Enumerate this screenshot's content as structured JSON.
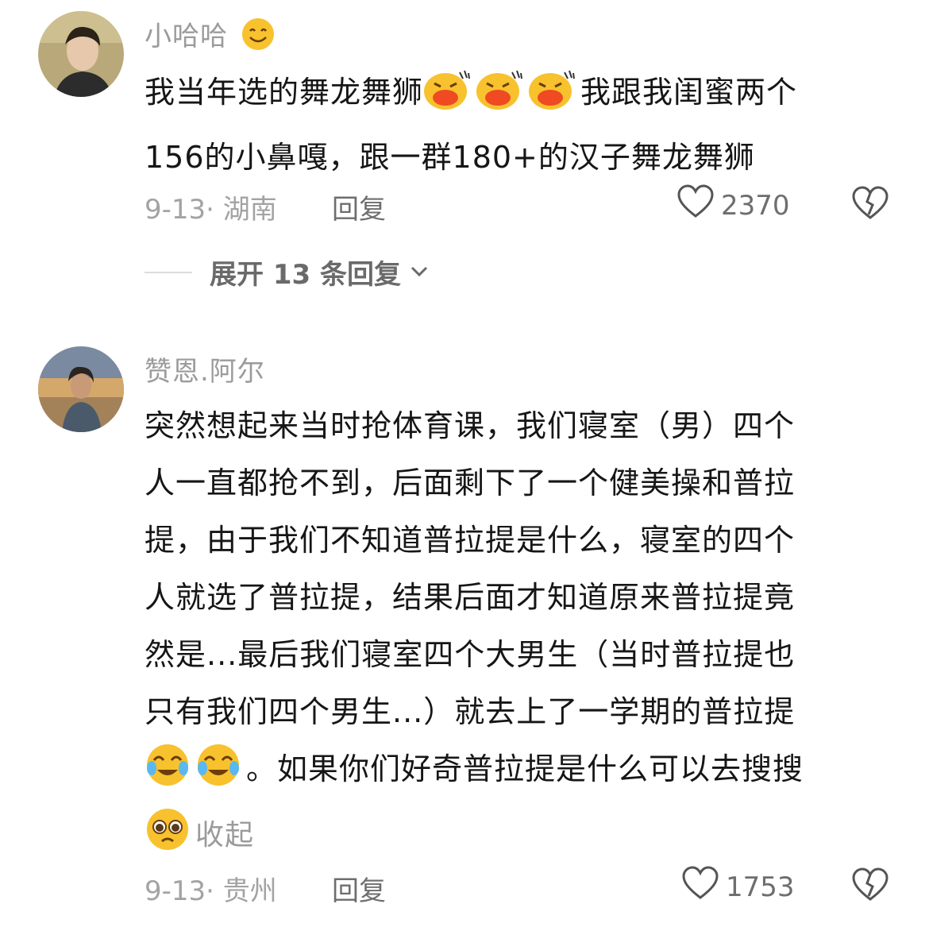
{
  "comments": [
    {
      "username": "小哈哈",
      "text_line1_before": "我当年选的舞龙舞狮",
      "text_line1_after": "我跟我闺蜜两个",
      "text_line2": "156的小鼻嘎，跟一群180+的汉子舞龙舞狮",
      "date_location": "9-13· 湖南",
      "reply_label": "回复",
      "likes": "2370",
      "expand_label": "展开 13 条回复"
    },
    {
      "username": "赞恩.阿尔",
      "text_lines": [
        "突然想起来当时抢体育课，我们寝室（男）四个",
        "人一直都抢不到，后面剩下了一个健美操和普拉",
        "提，由于我们不知道普拉提是什么，寝室的四个",
        "人就选了普拉提，结果后面才知道原来普拉提竟",
        "然是...最后我们寝室四个大男生（当时普拉提也",
        "只有我们四个男生...）就去上了一学期的普拉提"
      ],
      "text_line7": "。如果你们好奇普拉提是什么可以去搜搜",
      "collapse_label": "收起",
      "date_location": "9-13· 贵州",
      "reply_label": "回复",
      "likes": "1753"
    }
  ],
  "icons": {
    "username_emoji": "smiling-face-icon",
    "kiss_emoji": "kissing-face-icon",
    "crying_emoji": "crying-laughing-face-icon",
    "pleading_emoji": "pleading-face-icon",
    "like": "heart-outline-icon",
    "dislike": "broken-heart-icon",
    "expand": "chevron-down-icon"
  },
  "colors": {
    "username": "#9b9b9b",
    "meta": "#a3a3a3",
    "emoji_yellow": "#f7c22d",
    "emoji_lips": "#f04a22"
  }
}
